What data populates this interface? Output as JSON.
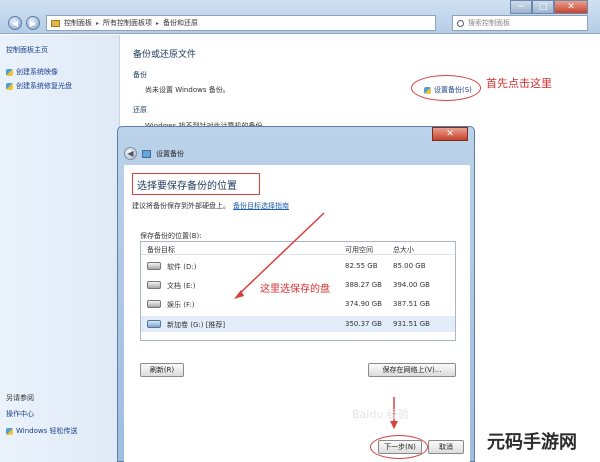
{
  "window": {
    "minimize_glyph": "−",
    "maximize_glyph": "□",
    "close_glyph": "✕",
    "back_glyph": "◀",
    "forward_glyph": "▶",
    "breadcrumb": [
      "控制面板",
      "所有控制面板项",
      "备份和还原"
    ],
    "breadcrumb_sep": "▸",
    "search_placeholder": "搜索控制面板"
  },
  "sidebar": {
    "home": "控制面板主页",
    "items": [
      "创建系统映像",
      "创建系统修复光盘"
    ],
    "see_also": "另请参阅",
    "action_center": "操作中心",
    "windows_transfer": "Windows 轻松传送"
  },
  "main": {
    "heading": "备份或还原文件",
    "backup_section": "备份",
    "backup_status": "尚未设置 Windows 备份。",
    "setup_link": "设置备份(S)",
    "restore_section": "还原",
    "restore_text": "Windows 找不到针对此计算机的备份。"
  },
  "annotations": {
    "first_click": "首先点击这里",
    "choose_disk": "这里选保存的盘"
  },
  "dialog": {
    "title": "设置备份",
    "close_glyph": "✕",
    "back_glyph": "◀",
    "heading": "选择要保存备份的位置",
    "recommend": "建议将备份保存到外部硬盘上。",
    "recommend_link": "备份目标选择指南",
    "location_label": "保存备份的位置(B):",
    "columns": [
      "备份目标",
      "可用空间",
      "总大小"
    ],
    "rows": [
      {
        "name": "软件 (D:)",
        "free": "82.55 GB",
        "total": "85.00 GB"
      },
      {
        "name": "文档 (E:)",
        "free": "388.27 GB",
        "total": "394.00 GB"
      },
      {
        "name": "娱乐 (F:)",
        "free": "374.90 GB",
        "total": "387.51 GB"
      },
      {
        "name": "新加卷 (G:) [推荐]",
        "free": "350.37 GB",
        "total": "931.51 GB"
      }
    ],
    "refresh_button": "刷新(R)",
    "network_button": "保存在网络上(V)...",
    "next_button": "下一步(N)",
    "cancel_button": "取消"
  },
  "brand": "元码手游网",
  "watermark": "Baidu 经验"
}
